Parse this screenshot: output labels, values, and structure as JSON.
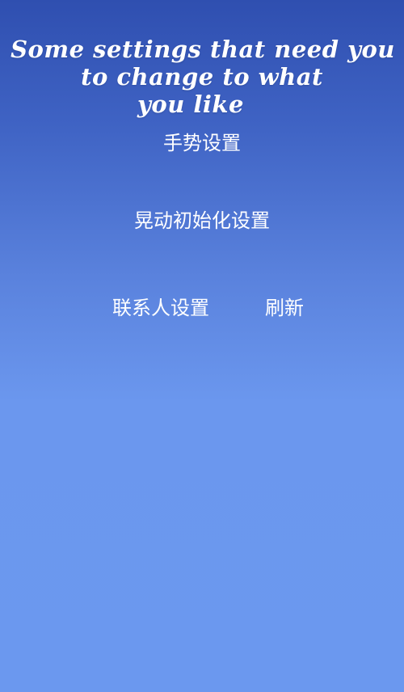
{
  "header": {
    "title_line1": "Some settings that need you",
    "title_line2": "to change to what",
    "title_line3": "you like"
  },
  "menu": {
    "gesture_settings": "手势设置",
    "shake_init_settings": "晃动初始化设置",
    "contact_settings": "联系人设置",
    "refresh": "刷新"
  },
  "colors": {
    "bg_top": "#2f4fb0",
    "bg_bottom": "#6b98ef",
    "text": "#ffffff"
  }
}
